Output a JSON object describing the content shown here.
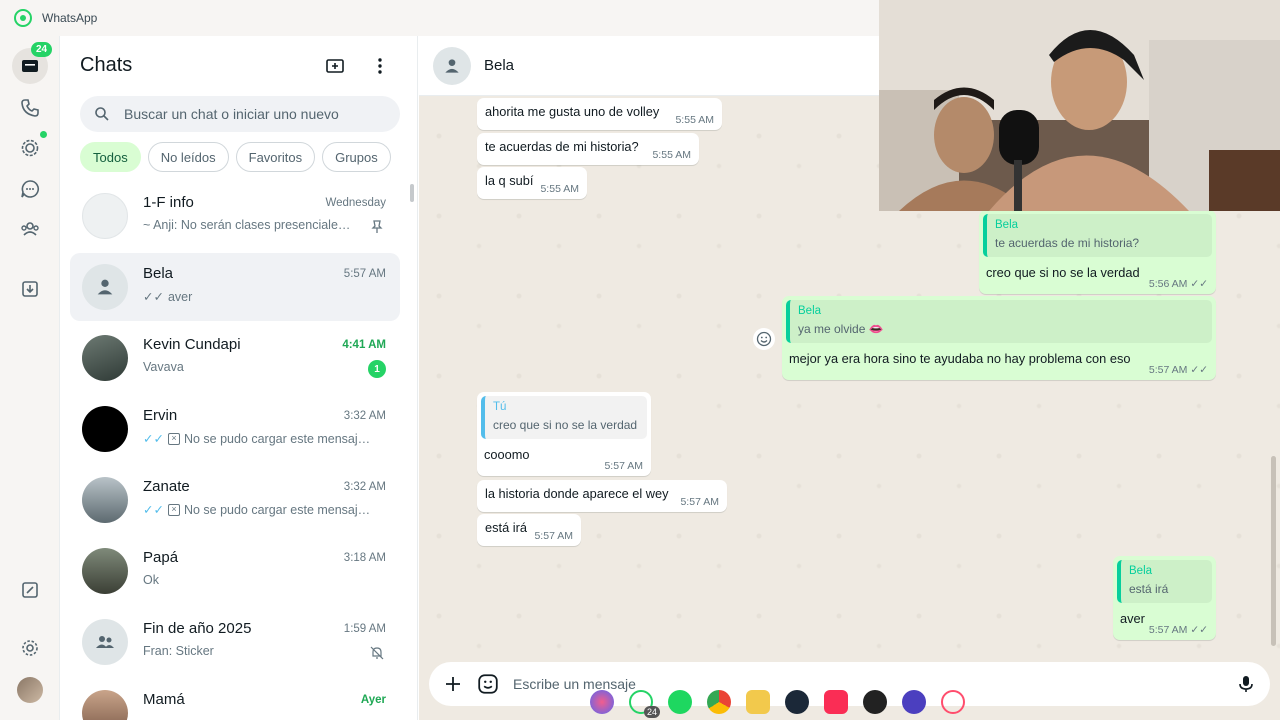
{
  "app": {
    "title": "WhatsApp"
  },
  "rail": {
    "chats_badge": "24"
  },
  "chat_list": {
    "title": "Chats",
    "search_placeholder": "Buscar un chat o iniciar uno nuevo",
    "filters": [
      "Todos",
      "No leídos",
      "Favoritos",
      "Grupos"
    ],
    "items": [
      {
        "name": "1-F info",
        "time": "Wednesday",
        "last": "~ Anji: No serán clases presenciale…",
        "pinned": true
      },
      {
        "name": "Bela",
        "time": "5:57 AM",
        "last": "aver",
        "ticks": "✓✓"
      },
      {
        "name": "Kevin Cundapi",
        "time": "4:41 AM",
        "last": "Vavava",
        "unread": "1"
      },
      {
        "name": "Ervin",
        "time": "3:32 AM",
        "last": "No se pudo cargar este mensaj…",
        "ticks": "✓✓"
      },
      {
        "name": "Zanate",
        "time": "3:32 AM",
        "last": "No se pudo cargar este mensaj…",
        "ticks": "✓✓"
      },
      {
        "name": "Papá",
        "time": "3:18 AM",
        "last": "Ok"
      },
      {
        "name": "Fin de año 2025",
        "time": "1:59 AM",
        "last": "Fran: Sticker",
        "muted": true
      },
      {
        "name": "Mamá",
        "time": "Ayer",
        "last": ""
      }
    ]
  },
  "conversation": {
    "contact_name": "Bela",
    "messages": [
      {
        "dir": "in",
        "text": "ahorita me gusta uno de volley",
        "time": "5:55 AM"
      },
      {
        "dir": "in",
        "text": "te acuerdas de mi historia?",
        "time": "5:55 AM"
      },
      {
        "dir": "in",
        "text": "la q subí",
        "time": "5:55 AM"
      },
      {
        "dir": "out",
        "quote_name": "Bela",
        "quote_text": "te acuerdas de mi historia?",
        "text": "creo que si no se la verdad",
        "time": "5:56 AM"
      },
      {
        "dir": "out",
        "quote_name": "Bela",
        "quote_text": "ya me olvide 👄",
        "text": "mejor ya era hora sino te ayudaba no hay problema con eso",
        "time": "5:57 AM"
      },
      {
        "dir": "in",
        "quote_name": "Tú",
        "quote_text": "creo que si no se la verdad",
        "text": "cooomo",
        "time": "5:57 AM"
      },
      {
        "dir": "in",
        "text": "la historia donde aparece el wey",
        "time": "5:57 AM"
      },
      {
        "dir": "in",
        "text": "está irá",
        "time": "5:57 AM"
      },
      {
        "dir": "out",
        "quote_name": "Bela",
        "quote_text": "está irá",
        "text": "aver",
        "time": "5:57 AM"
      }
    ],
    "composer_placeholder": "Escribe un mensaje"
  },
  "taskbar": {
    "whatsapp_badge": "24"
  },
  "colors": {
    "accent": "#25d366",
    "outgoing_bubble": "#d9fdd3",
    "chat_bg": "#efeae2"
  }
}
